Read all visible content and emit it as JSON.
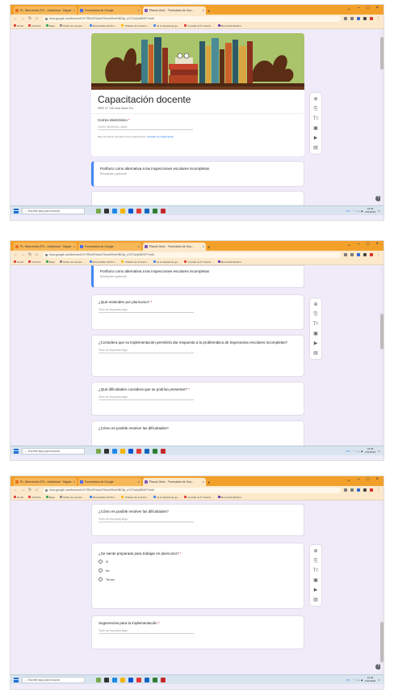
{
  "browser": {
    "tabs": [
      {
        "label": "PL: Bienvenido 2PL - Aulavirtual · Miguel"
      },
      {
        "label": "Formularios de Google"
      },
      {
        "label": "Planos Gest. · Formulario de Goo..."
      }
    ],
    "url": "docs.google.com/forms/d/1VYR0cZFeAm07tmuARmrHBC6p_sYZ7wXpl/BSIFY/edit",
    "bookmarks": [
      "Gmail",
      "YouTube",
      "Maps",
      "Orden de compra ...",
      "Microsoftde-LTE Pro...",
      "Trifasico de la Socio...",
      "La Conquista de ge...",
      "Contrato al P. Fraccio...",
      "Bienvenido Boletín...",
      "Management amuso..."
    ]
  },
  "form": {
    "title": "Capacitación docente",
    "description": "IPBE N° 135 José Marín Prz",
    "email_label": "Correo electrónico",
    "email_placeholder": "Correo electrónico válido",
    "email_note": "Este formulario recopila correos electrónicos.",
    "email_note_link": "Cambiar la configuración"
  },
  "questions": {
    "q_section": {
      "title": "Portfurio como alternativa a las inspecciones escolares incompletas",
      "desc": "Descripción (opcional)"
    },
    "q1": {
      "title": "¿Qué entienden por pluricurso?",
      "placeholder": "Texto de respuesta largo"
    },
    "q2": {
      "title": "¿Considera que su implementación permitiría dar respuesta a la problemática de trayectorias escolares incompletas?",
      "placeholder": "Texto de respuesta largo"
    },
    "q3": {
      "title": "¿Qué dificultades considera que se podrían presentar?",
      "placeholder": "Texto de respuesta largo"
    },
    "q4": {
      "title": "¿Cómo es posible resolver las dificultades?",
      "placeholder": "Texto de respuesta largo"
    },
    "q5": {
      "title": "¿Se siente preparado para trabajar en pluricurso?",
      "options": [
        "Sí",
        "No",
        "Tal vez"
      ]
    },
    "q6": {
      "title": "Sugerencias para la implementación",
      "placeholder": "Texto de respuesta largo"
    }
  },
  "taskbar": {
    "search": "Escribe aquí para buscar",
    "temp": "6°C",
    "time": "19:45",
    "date": "2/11/2023"
  },
  "colors": {
    "accent": "#4285f4",
    "page_bg": "#f0ebf8",
    "banner_header": "#6b3a1f",
    "required": "#d93025",
    "tabbar": "#f3a02b"
  },
  "icons": [
    "add-question-icon",
    "import-icon",
    "title-icon",
    "image-icon",
    "video-icon",
    "section-icon"
  ]
}
